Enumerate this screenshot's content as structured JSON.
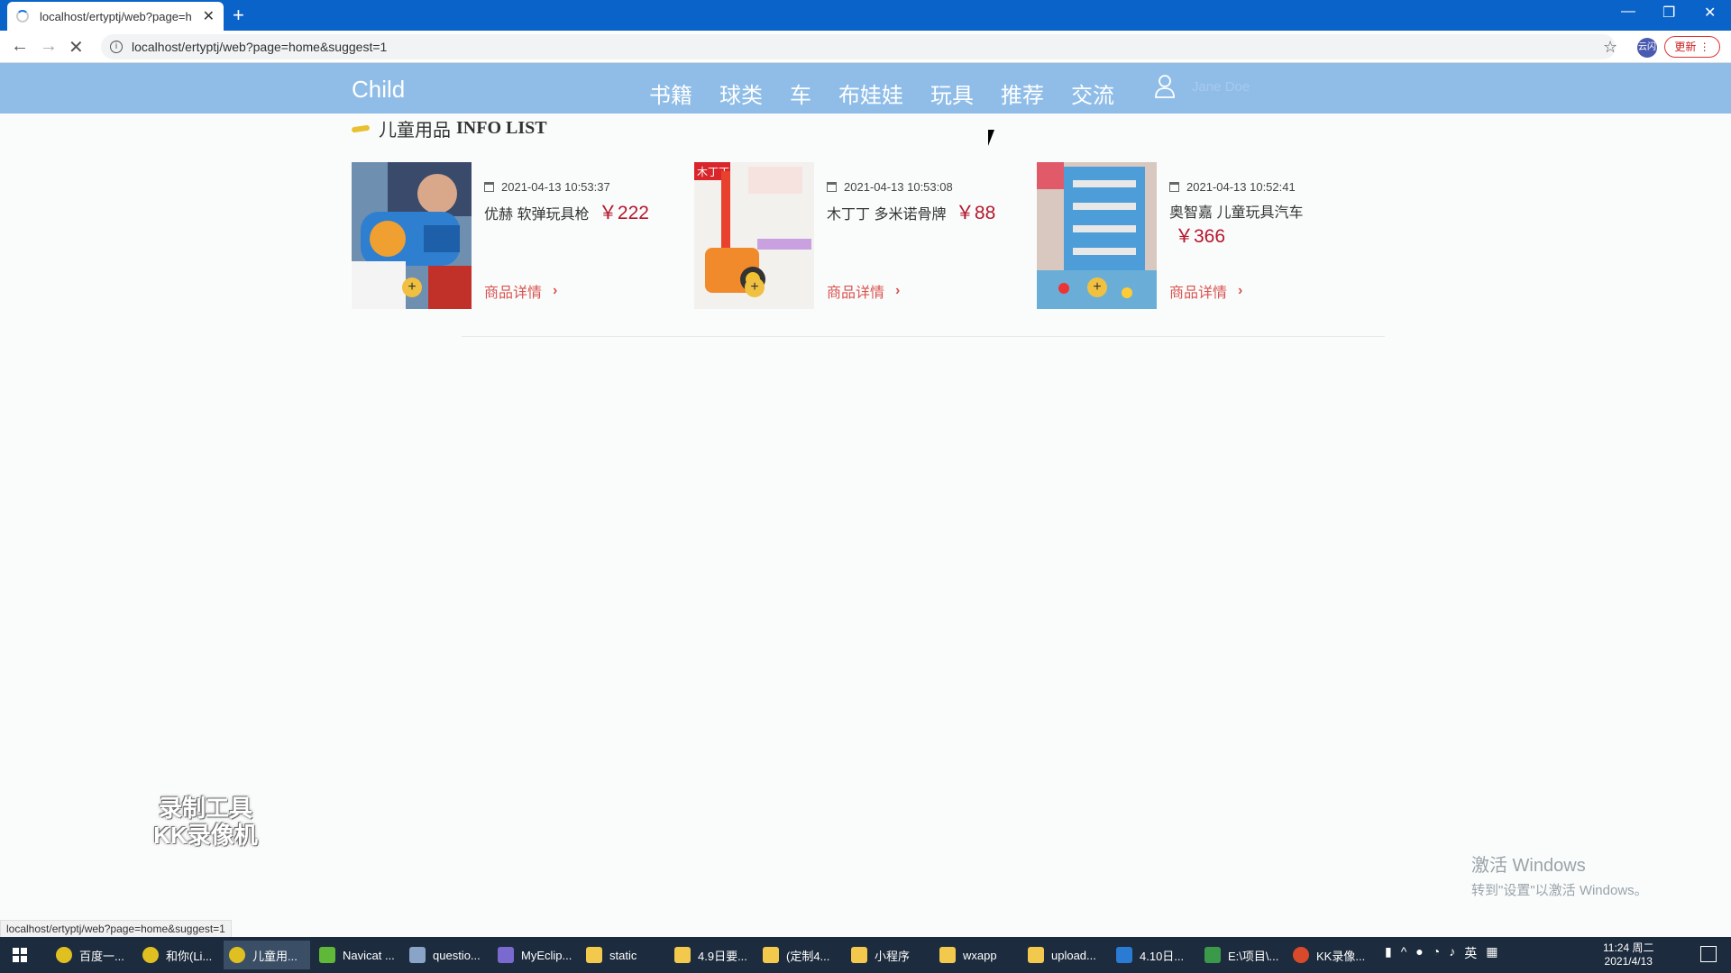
{
  "browser": {
    "tab_title": "localhost/ertyptj/web?page=h",
    "url": "localhost/ertyptj/web?page=home&suggest=1",
    "update_label": "更新",
    "ext_label": "云闪"
  },
  "site": {
    "logo": "Child",
    "nav": [
      "书籍",
      "球类",
      "车",
      "布娃娃",
      "玩具",
      "推荐",
      "交流"
    ],
    "user_name": "Jane Doe"
  },
  "section": {
    "title_cn": "儿童用品",
    "title_en": "INFO LIST"
  },
  "products": [
    {
      "date": "2021-04-13 10:53:37",
      "name": "优赫 软弹玩具枪",
      "price": "￥222",
      "detail": "商品详情"
    },
    {
      "date": "2021-04-13 10:53:08",
      "name": "木丁丁 多米诺骨牌",
      "price": "￥88",
      "detail": "商品详情"
    },
    {
      "date": "2021-04-13 10:52:41",
      "name": "奥智嘉 儿童玩具汽车",
      "price": "￥366",
      "detail": "商品详情"
    }
  ],
  "overlay": {
    "watermark_line1": "录制工具",
    "watermark_line2": "KK录像机",
    "activate_title": "激活 Windows",
    "activate_sub": "转到\"设置\"以激活 Windows。"
  },
  "status_url": "localhost/ertyptj/web?page=home&suggest=1",
  "taskbar": {
    "items": [
      "百度一...",
      "和你(Li...",
      "儿童用...",
      "Navicat ...",
      "questio...",
      "MyEclip...",
      "static",
      "4.9日要...",
      "(定制4...",
      "小程序",
      "wxapp",
      "upload...",
      "4.10日...",
      "E:\\项目\\...",
      "KK录像..."
    ],
    "ime": "英",
    "time": "11:24 周二",
    "date": "2021/4/13"
  }
}
